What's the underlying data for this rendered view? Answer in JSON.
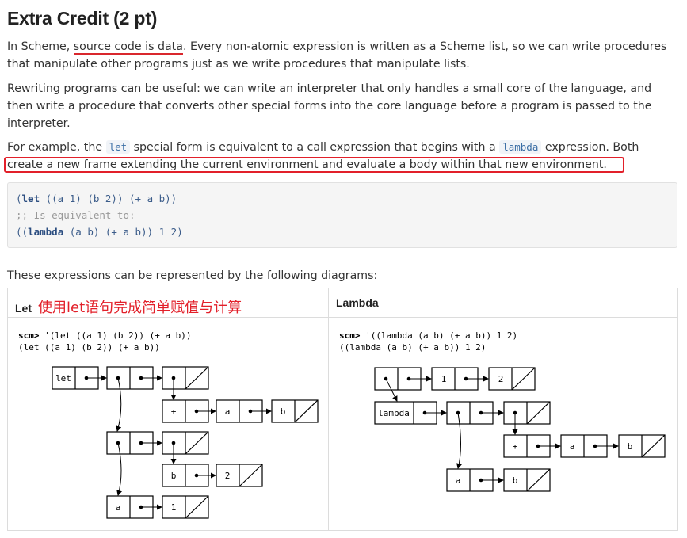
{
  "heading": "Extra Credit (2 pt)",
  "p1": {
    "pre": "In Scheme, ",
    "underlined": "source code is data",
    "post": ". Every non-atomic expression is written as a Scheme list, so we can write procedures that manipulate other programs just as we write procedures that manipulate lists."
  },
  "p2": "Rewriting programs can be useful: we can write an interpreter that only handles a small core of the language, and then write a procedure that converts other special forms into the core language before a program is passed to the interpreter.",
  "p3": {
    "a": "For example, the ",
    "code1": "let",
    "b": " special form is equivalent to a call expression that begins with a ",
    "code2": "lambda",
    "c": " expression. Both ",
    "d": "create a new frame extending the current environment and evaluate a body within that new environment."
  },
  "code": {
    "line1_kw": "let",
    "line1_rest": " ((a 1) (b 2)) (+ a b))",
    "line2": ";; Is equivalent to:",
    "line3_kw": "lambda",
    "line3_rest": " (a b) (+ a b)) 1 2)"
  },
  "p4": "These expressions can be represented by the following diagrams:",
  "table": {
    "left_header": "Let",
    "left_annotation": "使用let语句完成简单赋值与计算",
    "right_header": "Lambda",
    "left_prompt": "scm>",
    "left_input": " '(let ((a 1) (b 2)) (+ a b))",
    "left_output": "(let ((a 1) (b 2)) (+ a b))",
    "right_prompt": "scm>",
    "right_input": " '((lambda (a b) (+ a b)) 1 2)",
    "right_output": "((lambda (a b) (+ a b)) 1 2)"
  },
  "diagram_labels": {
    "let": "let",
    "plus": "+",
    "a": "a",
    "b": "b",
    "one": "1",
    "two": "2",
    "lambda": "lambda"
  },
  "colors": {
    "accent_red": "#e2202a",
    "code_blue": "#3b6ea5"
  }
}
